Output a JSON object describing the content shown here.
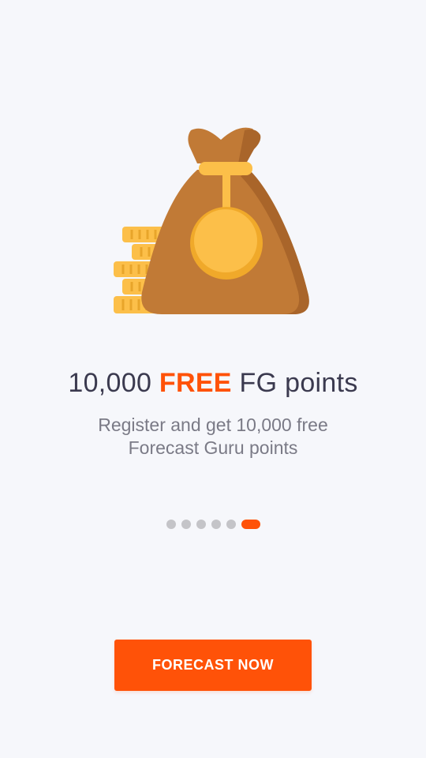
{
  "onboarding": {
    "illustration_icon": "money-bag-with-coins-icon",
    "headline_number": "10,000",
    "headline_accent": "FREE",
    "headline_rest": "FG points",
    "subtitle": "Register and get 10,000  free Forecast Guru points",
    "page_count": 6,
    "active_page": 6,
    "cta_label": "FORECAST NOW"
  },
  "colors": {
    "accent": "#ff5208",
    "background": "#f6f7fb",
    "title": "#3b3a4f",
    "subtitle": "#7a7a86",
    "dot_inactive": "#c4c4c8"
  }
}
